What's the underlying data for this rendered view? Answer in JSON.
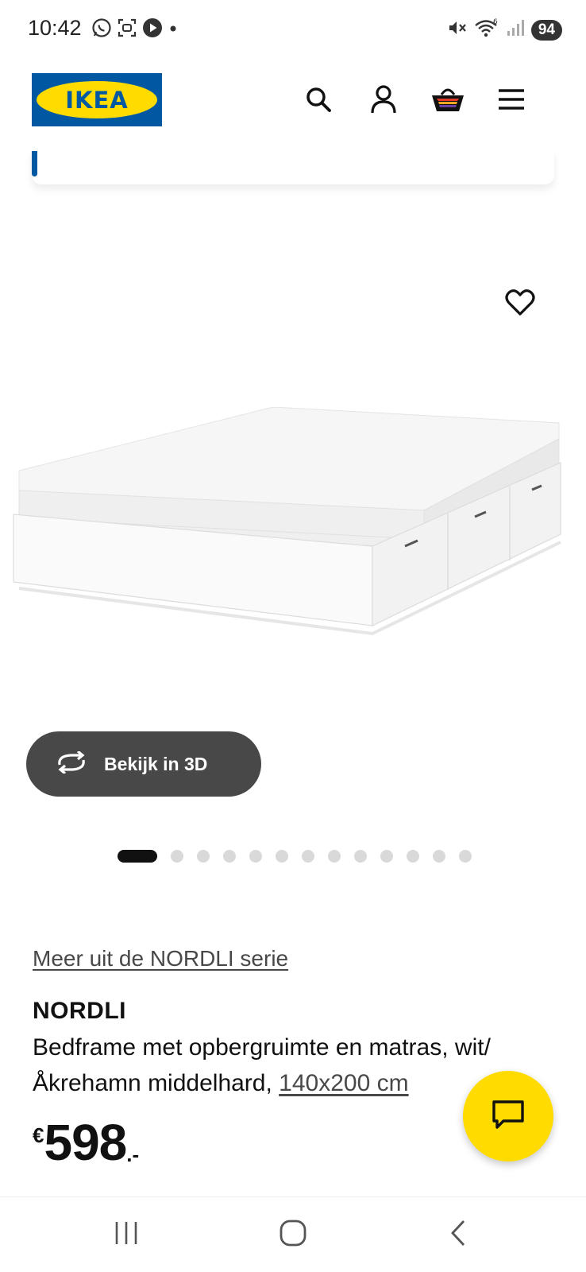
{
  "status_bar": {
    "time": "10:42",
    "battery": "94",
    "icons_left": [
      "whatsapp-icon",
      "screenshot-icon",
      "play-icon",
      "notification-dot"
    ],
    "icons_right": [
      "mute-icon",
      "wifi-icon",
      "signal-icon"
    ],
    "wifi_label": "6"
  },
  "header": {
    "logo_text": "IKEA",
    "icons": [
      "search-icon",
      "account-icon",
      "basket-icon",
      "menu-icon"
    ],
    "brand_colors": {
      "blue": "#0058a3",
      "yellow": "#ffdb00"
    }
  },
  "gallery": {
    "favorite_icon": "heart-icon",
    "view_3d_label": "Bekijk in 3D",
    "image_count": 13,
    "active_index": 0
  },
  "product": {
    "series_link": "Meer uit de NORDLI serie",
    "name": "NORDLI",
    "description": "Bedframe met opbergruimte en matras, wit/Åkrehamn middelhard, ",
    "size": "140x200 cm",
    "price_currency": "€",
    "price_amount": "598",
    "price_suffix": ".-"
  },
  "chat": {
    "icon": "chat-icon"
  },
  "nav": {
    "icons": [
      "recent-apps-icon",
      "home-icon",
      "back-icon"
    ]
  }
}
